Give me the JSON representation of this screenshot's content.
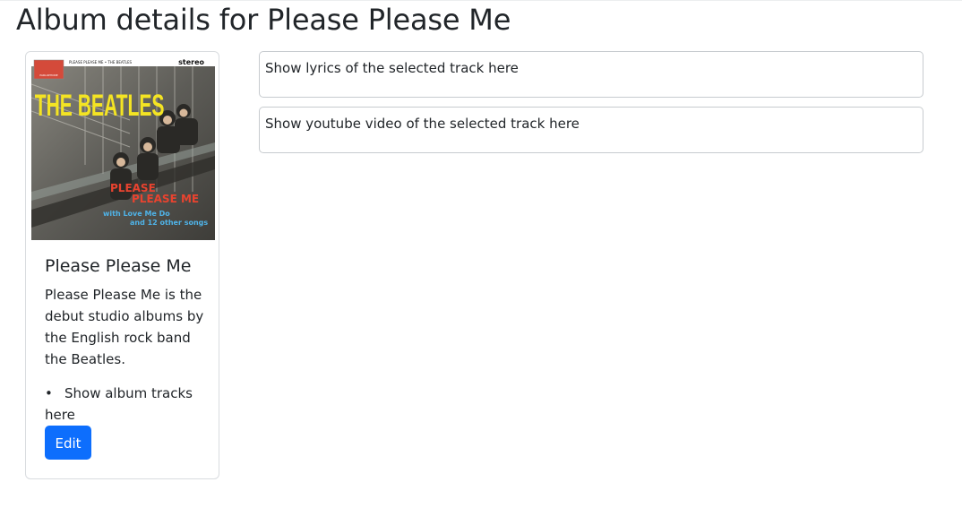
{
  "page": {
    "title": "Album details for Please Please Me"
  },
  "album": {
    "cover": {
      "top_line": "PLEASE PLEASE ME • THE BEATLES",
      "stereo": "stereo",
      "label": "PARLOPHONE",
      "band": "THE BEATLES",
      "title_line1": "PLEASE",
      "title_line2": "PLEASE ME",
      "sub_line1": "with Love Me Do",
      "sub_line2": "and 12 other songs"
    },
    "title": "Please Please Me",
    "description": "Please Please Me is the debut studio albums by the English rock band the Beatles.",
    "tracks_placeholder": "Show album tracks here",
    "edit_label": "Edit"
  },
  "panels": {
    "lyrics": "Show lyrics of the selected track here",
    "video": "Show youtube video of the selected track here"
  },
  "colors": {
    "primary": "#0d6efd",
    "border": "#d9dcdf"
  }
}
